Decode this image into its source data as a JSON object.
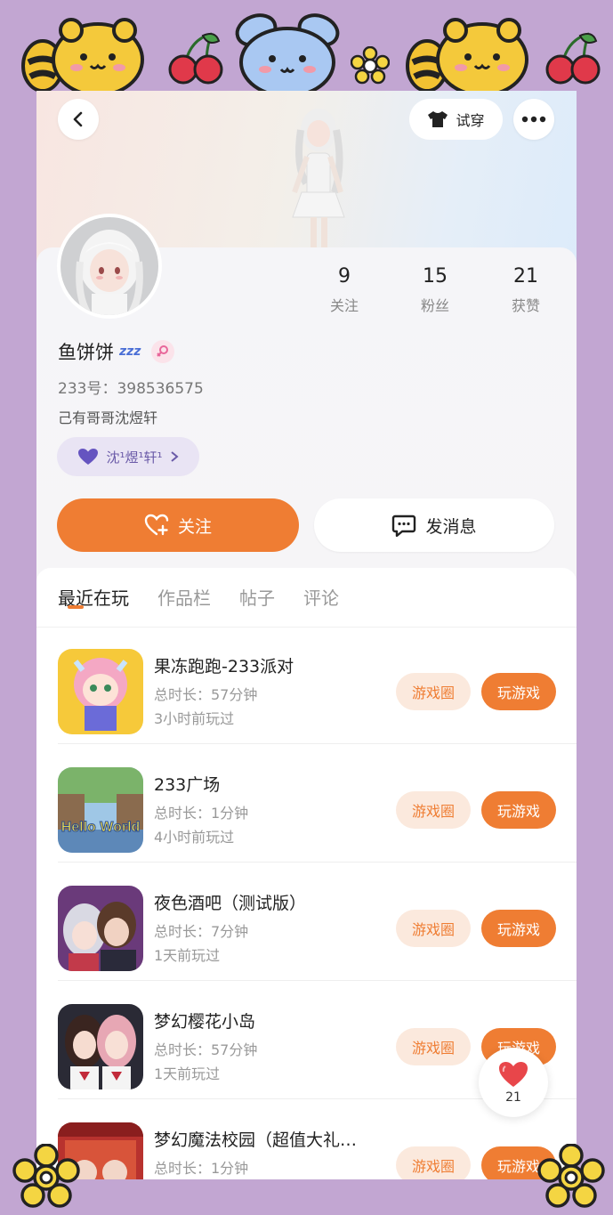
{
  "header": {
    "back_icon": "chevron-left-icon",
    "tryon_label": "试穿",
    "more_icon": "more-icon"
  },
  "profile": {
    "nickname": "鱼饼饼",
    "sleep_badge": "zzz",
    "gender": "female",
    "uid": "233号：398536575",
    "bio": "己有哥哥沈煜轩",
    "relation_label": "沈¹煜¹轩¹",
    "stats": [
      {
        "num": "9",
        "label": "关注"
      },
      {
        "num": "15",
        "label": "粉丝"
      },
      {
        "num": "21",
        "label": "获赞"
      }
    ],
    "follow_label": "关注",
    "message_label": "发消息"
  },
  "tabs": [
    {
      "label": "最近在玩",
      "active": true
    },
    {
      "label": "作品栏",
      "active": false
    },
    {
      "label": "帖子",
      "active": false
    },
    {
      "label": "评论",
      "active": false
    }
  ],
  "games": [
    {
      "name": "果冻跑跑-233派对",
      "duration": "总时长：57分钟",
      "last_played": "3小时前玩过",
      "circle_label": "游戏圈",
      "play_label": "玩游戏"
    },
    {
      "name": "233广场",
      "duration": "总时长：1分钟",
      "last_played": "4小时前玩过",
      "circle_label": "游戏圈",
      "play_label": "玩游戏",
      "thumb_text": "Hello World"
    },
    {
      "name": "夜色酒吧（测试版）",
      "duration": "总时长：7分钟",
      "last_played": "1天前玩过",
      "circle_label": "游戏圈",
      "play_label": "玩游戏"
    },
    {
      "name": "梦幻樱花小岛",
      "duration": "总时长：57分钟",
      "last_played": "1天前玩过",
      "circle_label": "游戏圈",
      "play_label": "玩游戏"
    },
    {
      "name": "梦幻魔法校园（超值大礼…",
      "duration": "总时长：1分钟",
      "last_played": "",
      "circle_label": "游戏圈",
      "play_label": "玩游戏"
    }
  ],
  "floating_like": {
    "icon": "heart-icon",
    "count": "21"
  },
  "colors": {
    "accent": "#ef7d33",
    "frame": "#c2a6d2"
  }
}
